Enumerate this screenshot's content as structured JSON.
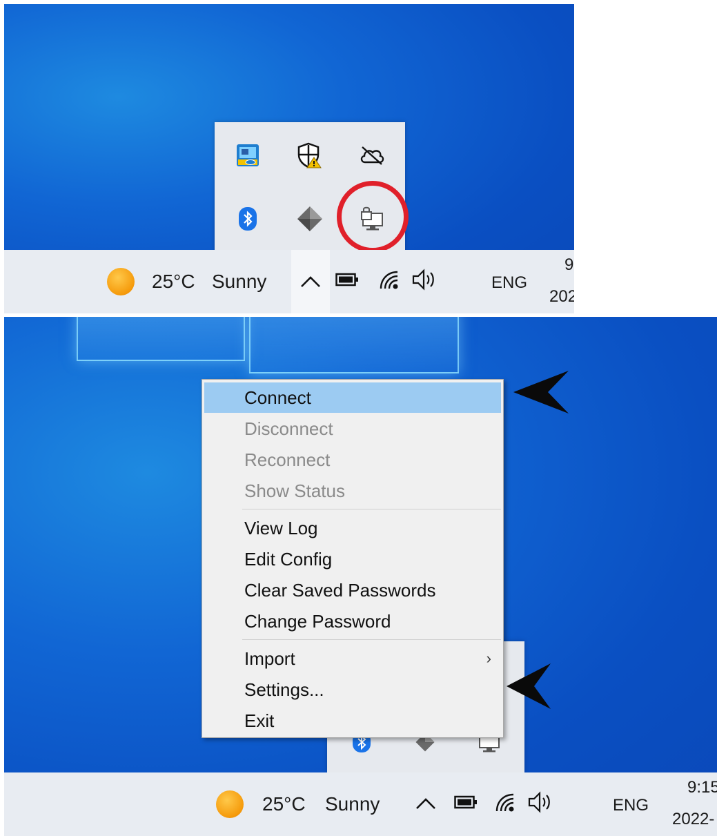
{
  "taskbar_top": {
    "temperature": "25°C",
    "condition": "Sunny",
    "language": "ENG",
    "time": "9",
    "date": "202"
  },
  "taskbar_bottom": {
    "temperature": "25°C",
    "condition": "Sunny",
    "language": "ENG",
    "time": "9:15",
    "date": "2022-"
  },
  "tray_icons": [
    "intel-graphics-icon",
    "security-warning-icon",
    "onedrive-offline-icon",
    "bluetooth-icon",
    "diamond-app-icon",
    "openvpn-monitor-lock-icon"
  ],
  "context_menu": {
    "items": [
      {
        "label": "Connect",
        "enabled": true,
        "highlighted": true
      },
      {
        "label": "Disconnect",
        "enabled": false
      },
      {
        "label": "Reconnect",
        "enabled": false
      },
      {
        "label": "Show Status",
        "enabled": false
      },
      {
        "label": "View Log",
        "enabled": true
      },
      {
        "label": "Edit Config",
        "enabled": true
      },
      {
        "label": "Clear Saved Passwords",
        "enabled": true
      },
      {
        "label": "Change Password",
        "enabled": true
      },
      {
        "label": "Import",
        "enabled": true,
        "submenu": true
      },
      {
        "label": "Settings...",
        "enabled": true
      },
      {
        "label": "Exit",
        "enabled": true
      }
    ],
    "submenu_glyph": "›"
  },
  "colors": {
    "highlight_ring": "#e0202a",
    "menu_highlight": "#9ccbf2",
    "disabled_text": "#8a8a8a"
  }
}
